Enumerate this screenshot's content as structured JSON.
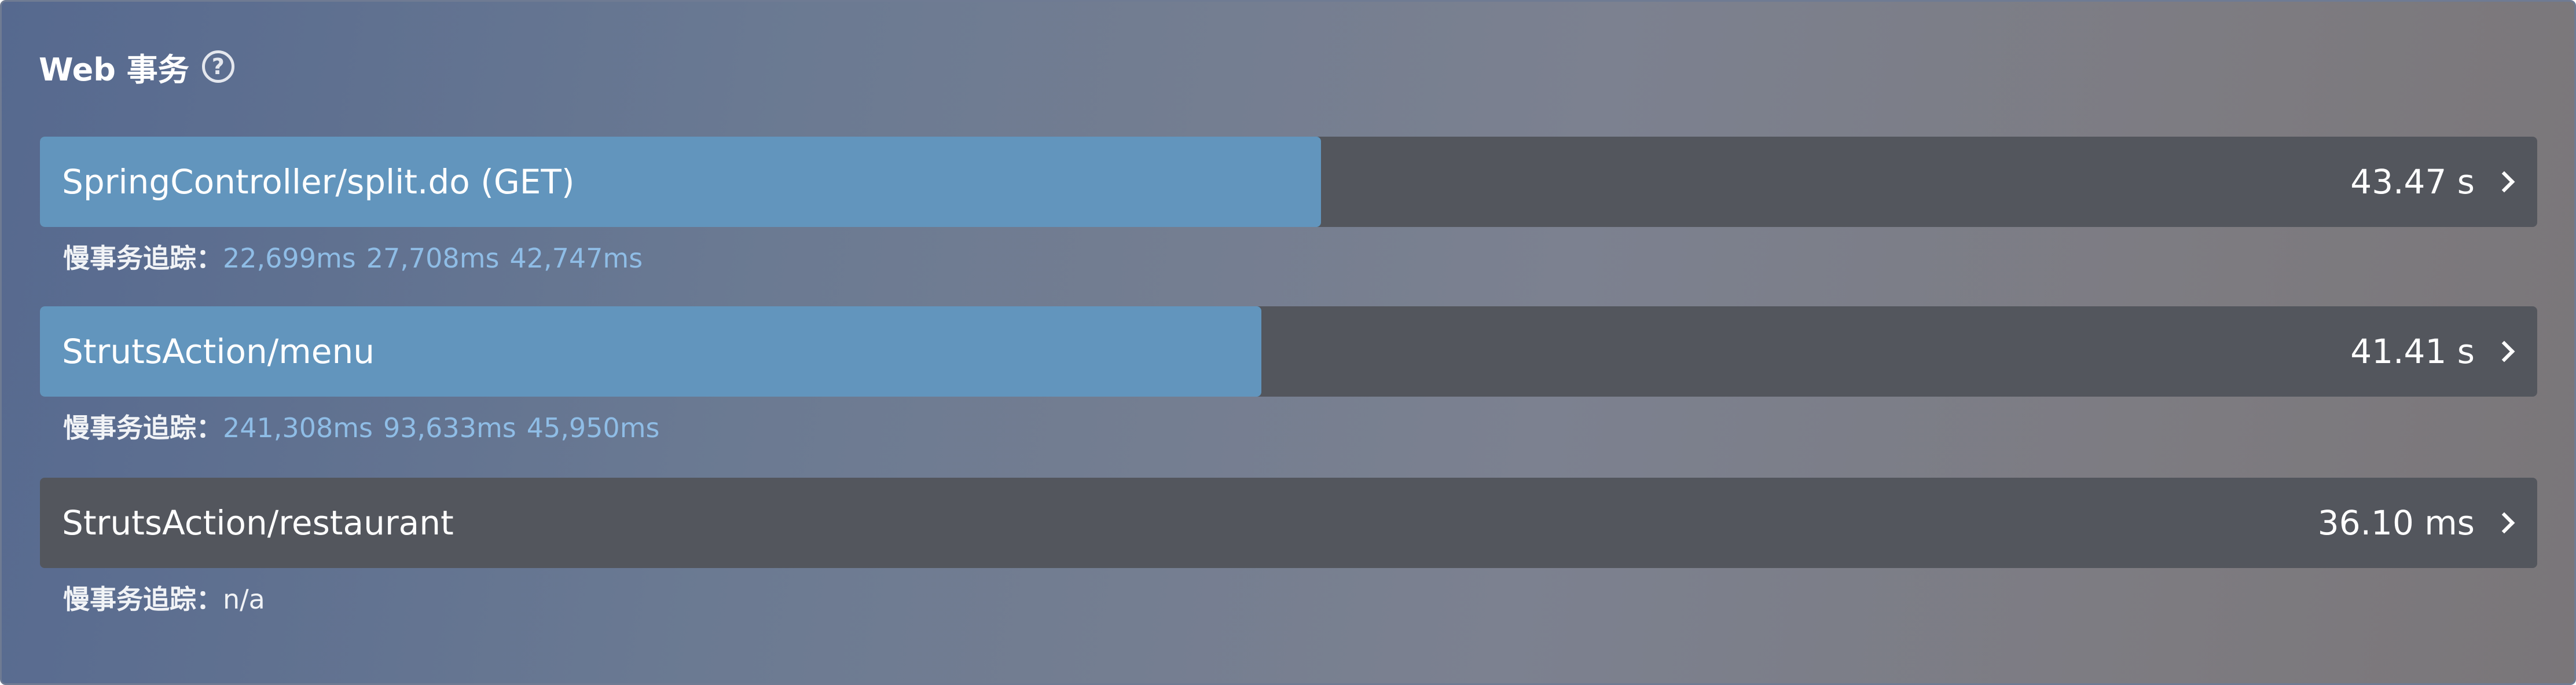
{
  "panel": {
    "title": "Web 事务",
    "help_icon": "?"
  },
  "slow_trace_label": "慢事务追踪：",
  "transactions": [
    {
      "name": "SpringController/split.do (GET)",
      "time": "43.47 s",
      "relative_share": 0.513,
      "traces": [
        "22,699ms",
        "27,708ms",
        "42,747ms"
      ]
    },
    {
      "name": "StrutsAction/menu",
      "time": "41.41 s",
      "relative_share": 0.489,
      "traces": [
        "241,308ms",
        "93,633ms",
        "45,950ms"
      ]
    },
    {
      "name": "StrutsAction/restaurant",
      "time": "36.10 ms",
      "relative_share": 0,
      "trace_none": "n/a"
    }
  ],
  "colors": {
    "bar_fill": "#6295bd",
    "bar_track": "#53565d",
    "trace_link": "#8fbde6"
  },
  "icons": {
    "help": "question-circle-icon",
    "chevron": "chevron-right-icon"
  }
}
